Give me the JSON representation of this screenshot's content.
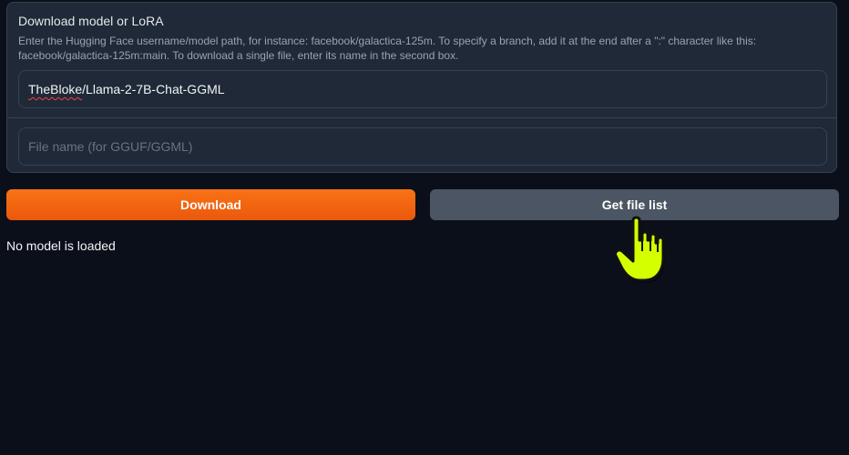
{
  "download_panel": {
    "title": "Download model or LoRA",
    "info_line1": "Enter the Hugging Face username/model path, for instance: facebook/galactica-125m. To specify a branch, add it at the end after a \":\" character like this:",
    "info_line2": "facebook/galactica-125m:main. To download a single file, enter its name in the second box.",
    "model_input_value_part1": "TheBloke",
    "model_input_value_part2": "/Llama-2-7B-Chat-GGML",
    "file_input_placeholder": "File name (for GGUF/GGML)"
  },
  "buttons": {
    "download_label": "Download",
    "get_file_list_label": "Get file list"
  },
  "status_text": "No model is loaded",
  "colors": {
    "accent_orange": "#f97316",
    "secondary_button": "#4b5563",
    "cursor_highlight": "#d4ff00"
  },
  "icons": {
    "cursor": "hand-pointer-icon"
  }
}
